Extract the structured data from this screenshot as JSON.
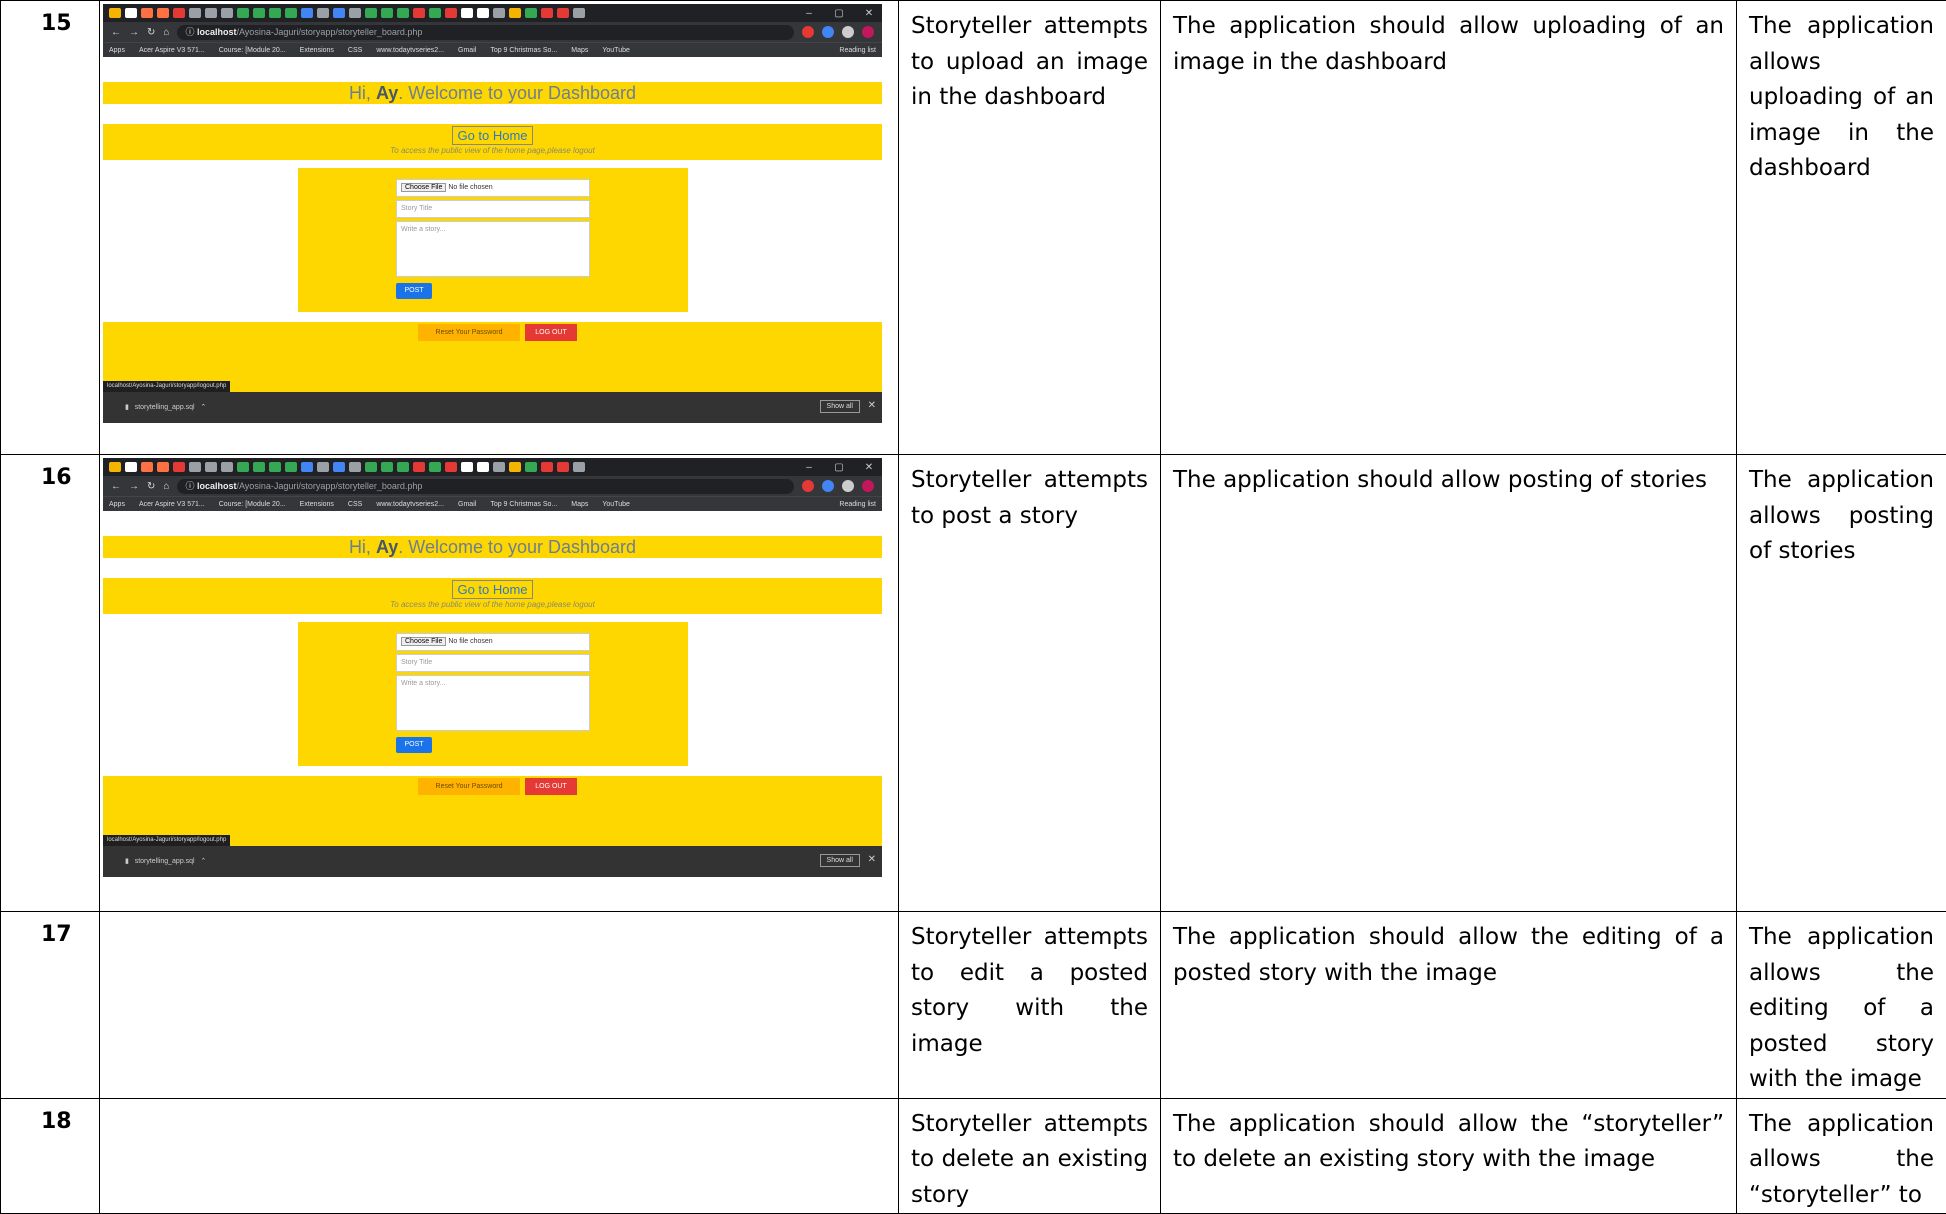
{
  "rows": [
    {
      "num": "15",
      "has_shot": true,
      "action": "Storyteller attempts to upload an image in the dashboard",
      "expected": "The application should allow uploading of an image in the dashboard",
      "actual": "The application allows uploading of an image in the dashboard"
    },
    {
      "num": "16",
      "has_shot": true,
      "action": "Storyteller attempts to post a story",
      "expected": "The application should allow posting of stories",
      "actual": "The application allows posting of stories"
    },
    {
      "num": "17",
      "has_shot": false,
      "action": "Storyteller attempts to edit a posted story with the image",
      "expected": "The application should allow the editing of a posted story with the image",
      "actual": "The application allows the editing of a posted story with the image"
    },
    {
      "num": "18",
      "has_shot": false,
      "action": "Storyteller attempts to delete an existing story",
      "expected": "The application should allow the “storyteller” to delete an existing story with the image",
      "actual": "The application allows the “storyteller” to"
    }
  ],
  "browser": {
    "shots": [
      {
        "url_host": "localhost",
        "url_path": "/Ayosina-Jaguri/storyapp/storyteller_board.php"
      },
      {
        "url_host": "localhost",
        "url_path": "/Ayosina-Jaguri/storyapp/storyteller_board.php"
      }
    ],
    "bookmarks": [
      "Apps",
      "Acer Aspire V3 571...",
      "Course: [Module 20...",
      "Extensions",
      "CSS",
      "www.todaytvseries2...",
      "Gmail",
      "Top 9 Christmas So...",
      "Maps",
      "YouTube"
    ],
    "reading_list": "Reading list",
    "welcome_pre": "Hi, ",
    "welcome_name": "Ay",
    "welcome_post": ". Welcome to your Dashboard",
    "home_button": "Go to Home",
    "home_hint": "To access the public view of the home page,please logout",
    "choose_file": "Choose File",
    "no_file": "No file chosen",
    "title_placeholder": "Story Title",
    "story_placeholder": "Write a story...",
    "post_button": "POST",
    "reset_button": "Reset Your Password",
    "logout_button": "LOG OUT",
    "status_url": "localhost/Ayosina-Jaguri/storyapp/logout.php",
    "download_file": "storytelling_app.sql",
    "show_all": "Show all"
  },
  "colors": {
    "accent": "#ffd700",
    "post": "#1a73e8",
    "logout": "#e53935",
    "reset": "#ffb300"
  }
}
